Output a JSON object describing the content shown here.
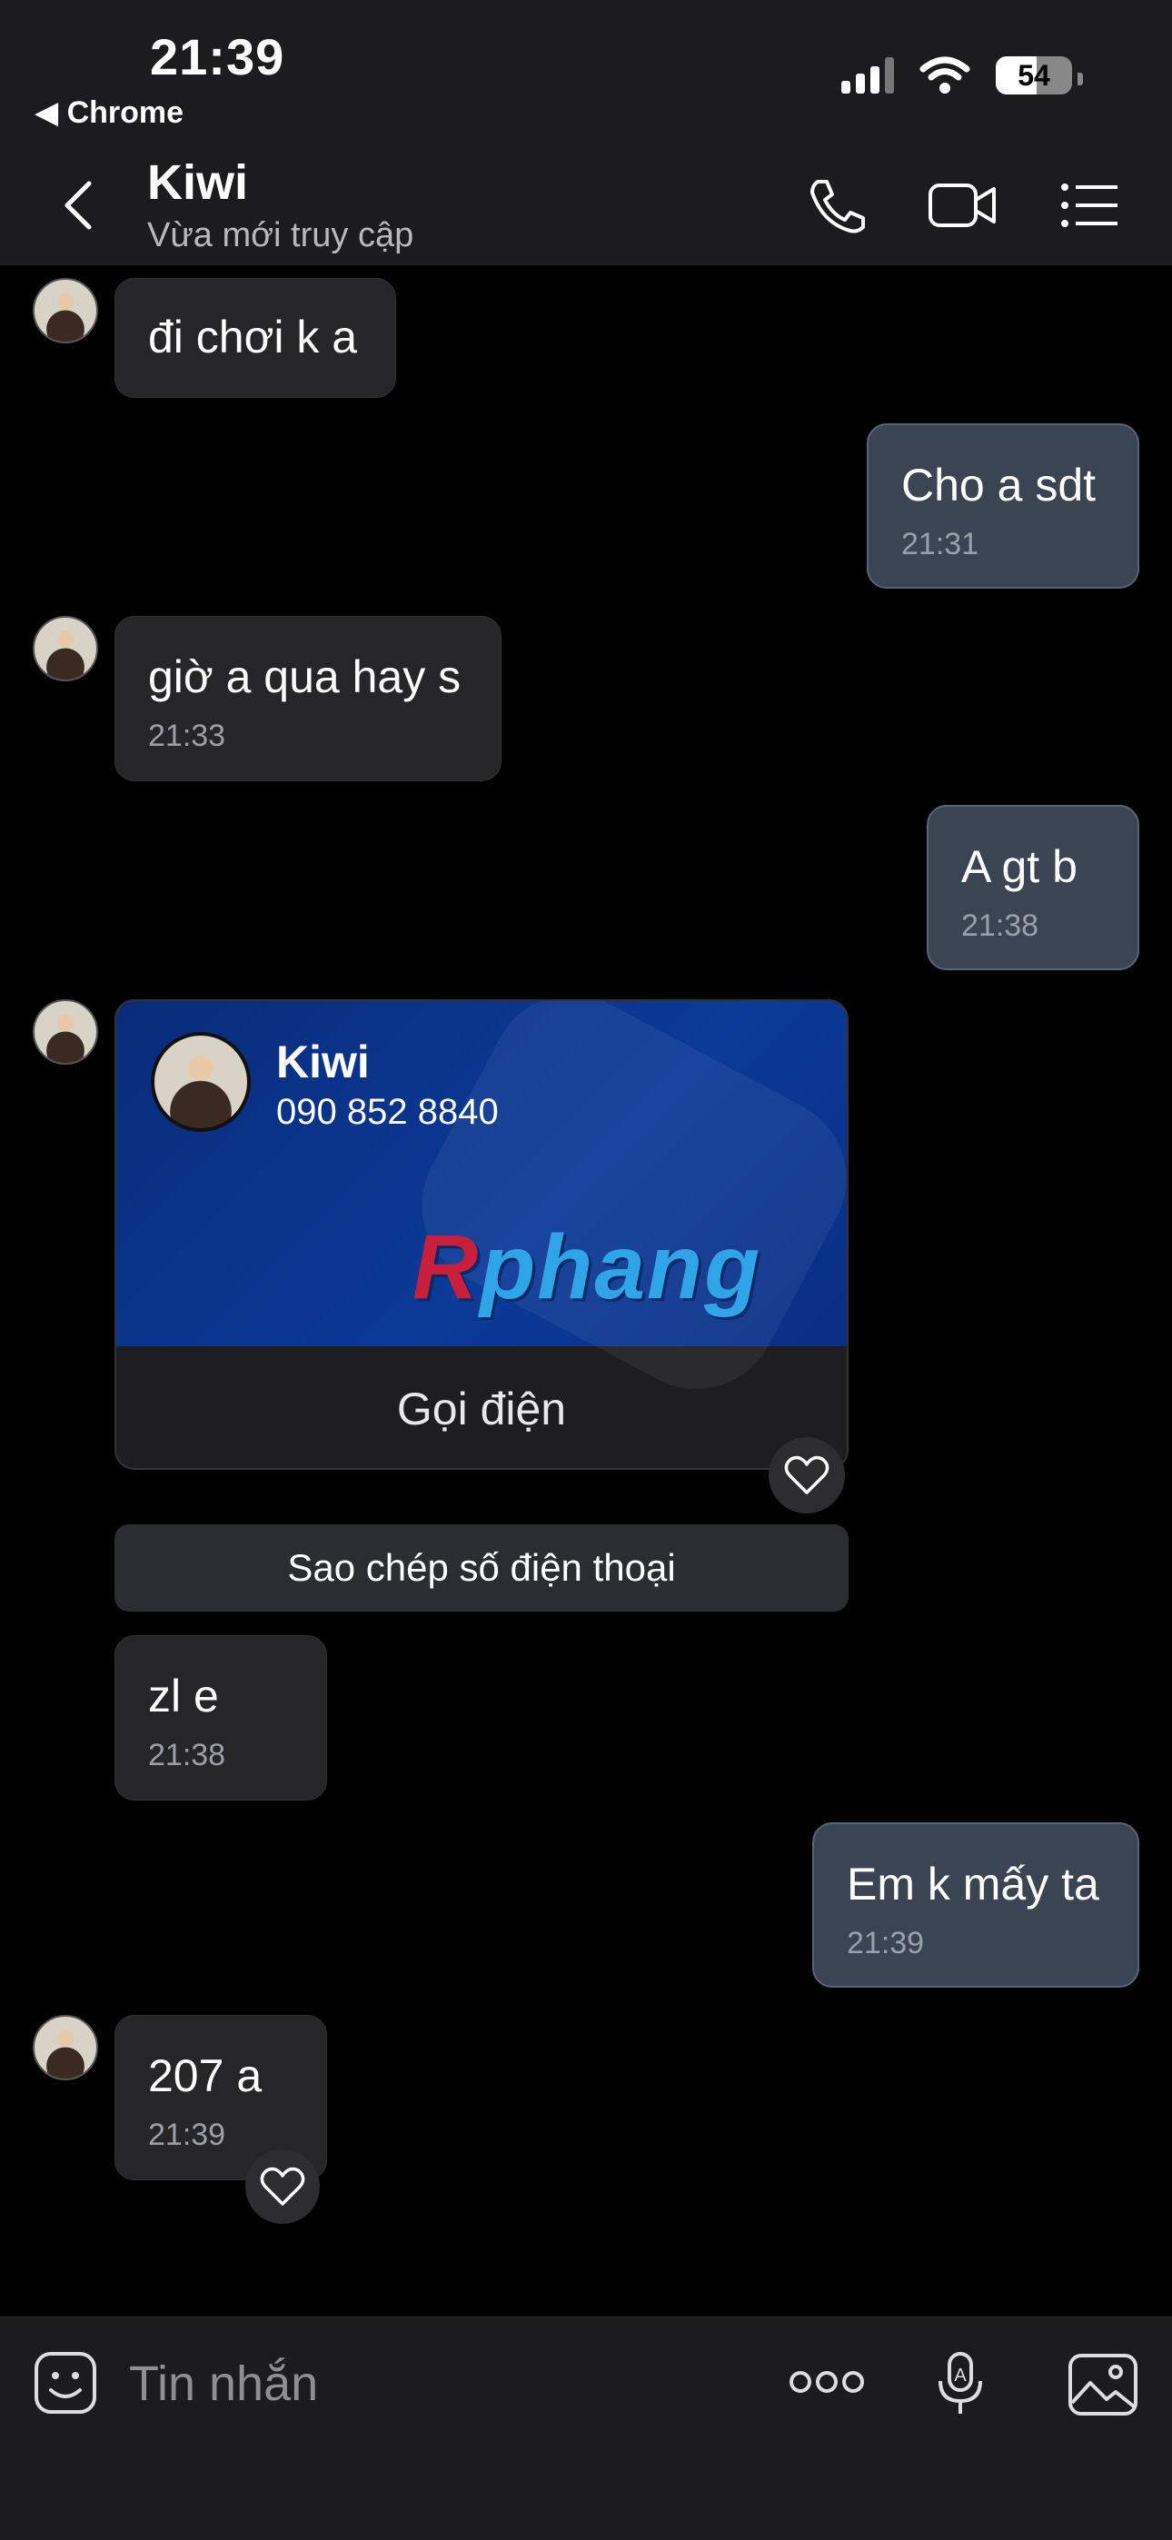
{
  "status_bar": {
    "time": "21:39",
    "back_app": "Chrome",
    "battery": 54
  },
  "header": {
    "name": "Kiwi",
    "status": "Vừa mới truy cập"
  },
  "messages": [
    {
      "dir": "in",
      "text": "đi chơi k a",
      "time": ""
    },
    {
      "dir": "out",
      "text": "Cho a sdt",
      "time": "21:31"
    },
    {
      "dir": "in",
      "text": "giờ a qua hay s",
      "time": "21:33"
    },
    {
      "dir": "out",
      "text": "A gt b",
      "time": "21:38"
    },
    {
      "dir": "in",
      "text": "zl e",
      "time": "21:38"
    },
    {
      "dir": "out",
      "text": "Em k mấy ta",
      "time": "21:39"
    },
    {
      "dir": "in",
      "text": "207 a",
      "time": "21:39"
    }
  ],
  "contact_card": {
    "name": "Kiwi",
    "phone": "090 852 8840",
    "logo_r": "R",
    "logo_rest": "phang",
    "call_label": "Gọi điện",
    "copy_label": "Sao chép số điện thoại"
  },
  "input": {
    "placeholder": "Tin nhắn"
  },
  "icons": {
    "back": "chevron-left-icon",
    "call": "phone-icon",
    "video": "video-icon",
    "menu": "list-icon",
    "heart": "heart-icon",
    "emoji": "emoji-icon",
    "more": "more-icon",
    "mic": "mic-icon",
    "image": "image-icon"
  },
  "colors": {
    "header_bg": "#1c1c1e",
    "incoming_bubble": "#262628",
    "outgoing_bubble": "#3a4452",
    "card_blue": "#0b3a98"
  }
}
